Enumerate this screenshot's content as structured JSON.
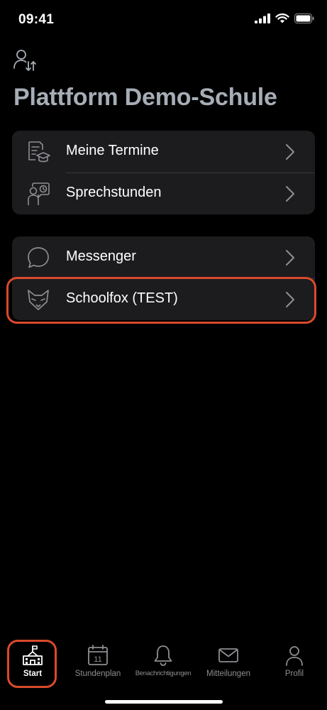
{
  "status_bar": {
    "time": "09:41"
  },
  "header": {
    "school_name": "Plattform Demo-Schule"
  },
  "menu_group_1": [
    {
      "label": "Meine Termine",
      "icon": "appointments-icon"
    },
    {
      "label": "Sprechstunden",
      "icon": "office-hours-icon"
    }
  ],
  "menu_group_2": [
    {
      "label": "Messenger",
      "icon": "chat-bubble-icon"
    },
    {
      "label": "Schoolfox (TEST)",
      "icon": "fox-icon"
    }
  ],
  "tab_bar": {
    "tabs": [
      {
        "label": "Start",
        "icon": "school-icon",
        "active": true
      },
      {
        "label": "Stundenplan",
        "icon": "calendar-icon",
        "calendar_day": "11"
      },
      {
        "label": "Benachrichtigungen",
        "icon": "bell-icon"
      },
      {
        "label": "Mitteilungen",
        "icon": "mail-icon"
      },
      {
        "label": "Profil",
        "icon": "person-icon"
      }
    ]
  },
  "colors": {
    "background": "#000000",
    "card": "#1c1c1e",
    "title": "#a6adb6",
    "highlight": "#d94a2c",
    "inactive_tab": "#8e8e93"
  }
}
